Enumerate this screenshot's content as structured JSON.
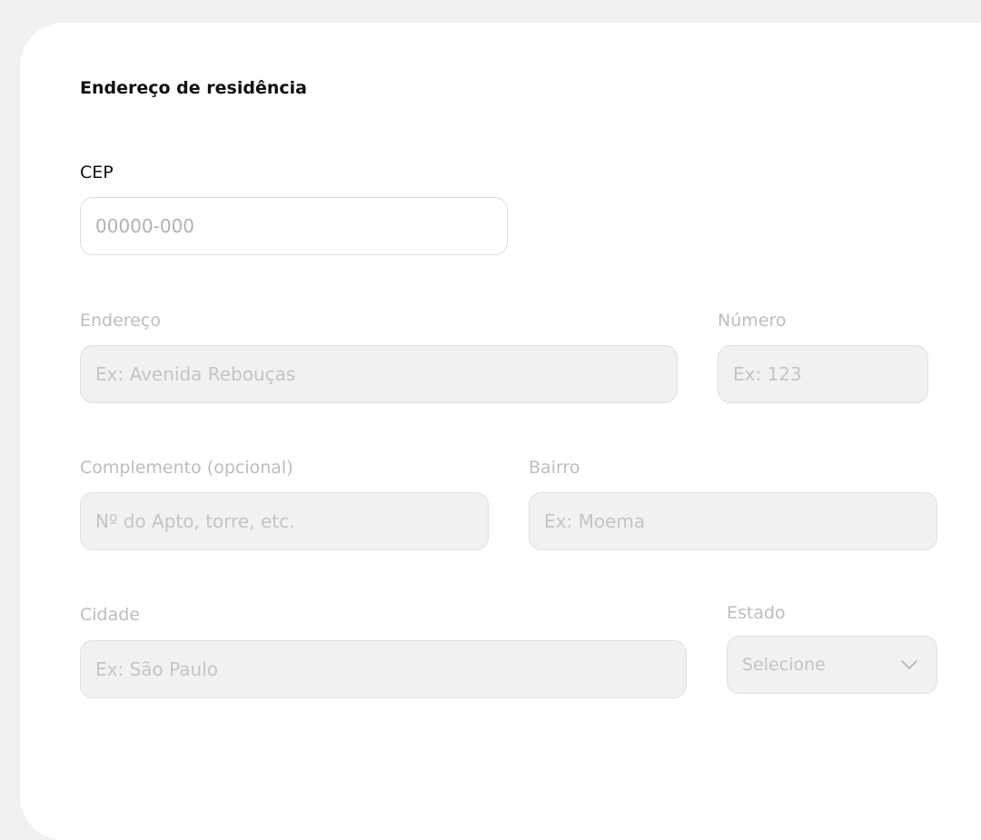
{
  "form": {
    "section_title": "Endereço de residência",
    "cep": {
      "label": "CEP",
      "placeholder": "00000-000",
      "value": ""
    },
    "endereco": {
      "label": "Endereço",
      "placeholder": "Ex: Avenida Rebouças",
      "value": ""
    },
    "numero": {
      "label": "Número",
      "placeholder": "Ex: 123",
      "value": ""
    },
    "complemento": {
      "label": "Complemento (opcional)",
      "placeholder": "Nº do Apto, torre, etc.",
      "value": ""
    },
    "bairro": {
      "label": "Bairro",
      "placeholder": "Ex: Moema",
      "value": ""
    },
    "cidade": {
      "label": "Cidade",
      "placeholder": "Ex: São Paulo",
      "value": ""
    },
    "estado": {
      "label": "Estado",
      "selected": "Selecione",
      "icon": "chevron-down-icon"
    }
  },
  "colors": {
    "page_background": "#f2f1f0",
    "card_background": "#ffffff",
    "text_primary": "#111111",
    "text_disabled": "#bdbdbd",
    "field_disabled_background": "#f1f1f1",
    "field_border": "#dcdcdc"
  }
}
